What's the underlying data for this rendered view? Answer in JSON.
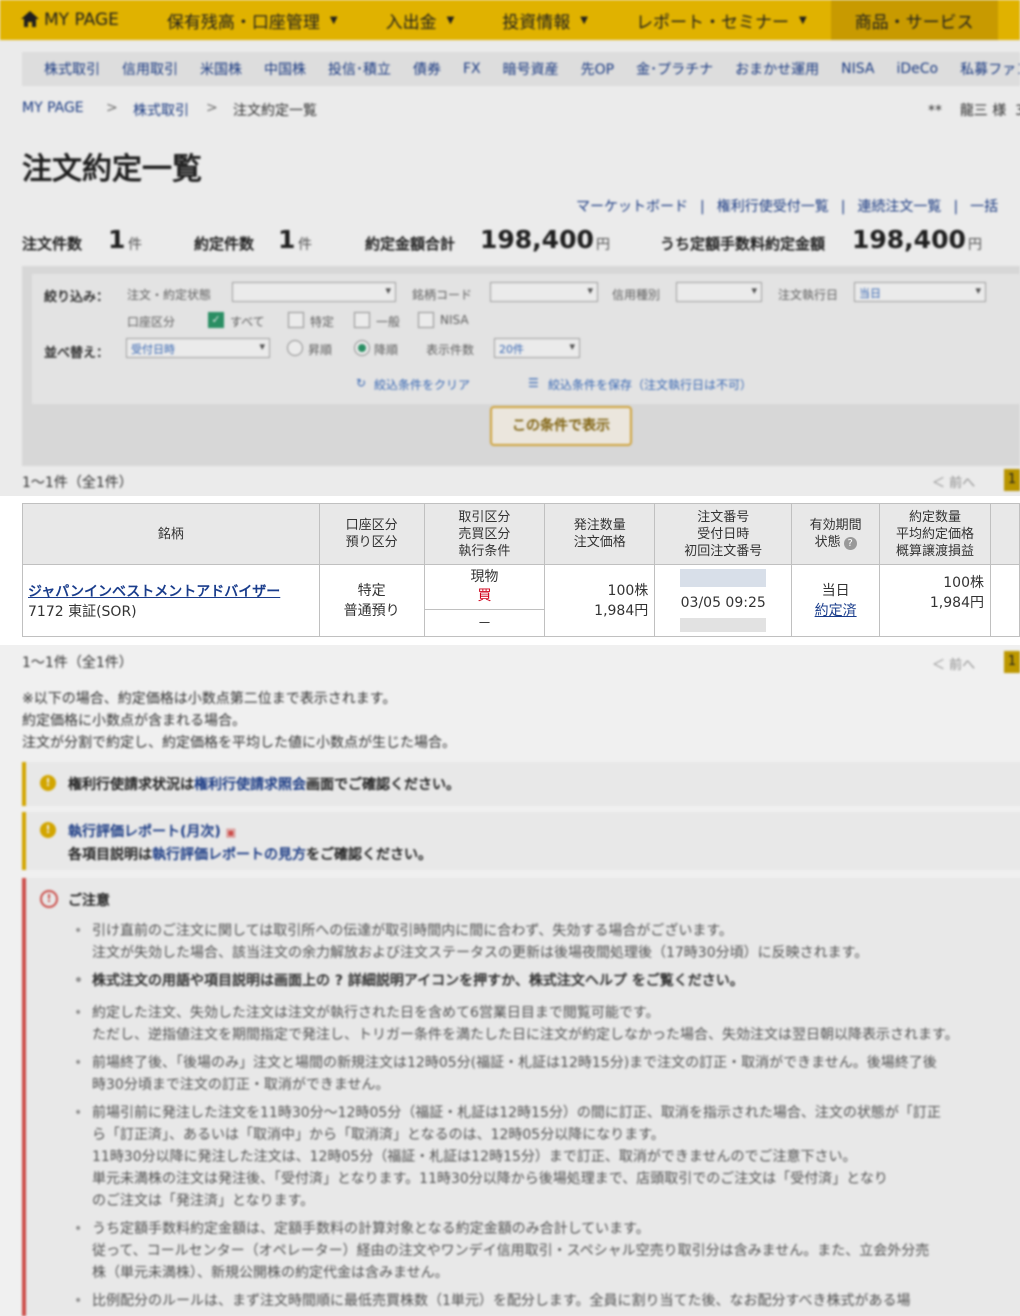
{
  "topnav": {
    "home": "MY PAGE",
    "items": [
      "保有残高・口座管理",
      "入出金",
      "投資情報",
      "レポート・セミナー",
      "商品・サービス"
    ]
  },
  "subnav": [
    "株式取引",
    "信用取引",
    "米国株",
    "中国株",
    "投信･積立",
    "債券",
    "FX",
    "暗号資産",
    "先OP",
    "金･プラチナ",
    "おまかせ運用",
    "NISA",
    "iDeCo",
    "私募ファンド"
  ],
  "breadcrumb": {
    "home": "MY PAGE",
    "sep": ">",
    "section": "株式取引",
    "current": "注文約定一覧"
  },
  "user": {
    "stars": "**",
    "name": "龍三 様",
    "trail": "3"
  },
  "page_title": "注文約定一覧",
  "links": {
    "market_board": "マーケットボード",
    "rights": "権利行使受付一覧",
    "chain": "連続注文一覧",
    "bulk": "一括",
    "sep": "|"
  },
  "summary": {
    "orders_label": "注文件数",
    "orders_value": "1",
    "orders_unit": "件",
    "exec_label": "約定件数",
    "exec_value": "1",
    "exec_unit": "件",
    "total_label": "約定金額合計",
    "total_value": "198,400",
    "total_unit": "円",
    "fixed_label": "うち定額手数料約定金額",
    "fixed_value": "198,400",
    "fixed_unit": "円"
  },
  "filter": {
    "narrow_label": "絞り込み：",
    "status_label": "注文・約定状態",
    "code_label": "銘柄コード",
    "margin_label": "信用種別",
    "exec_date_label": "注文執行日",
    "exec_date_value": "当日",
    "account_label": "口座区分",
    "acc_all": "すべて",
    "acc_specific": "特定",
    "acc_general": "一般",
    "acc_nisa": "NISA",
    "sort_label": "並べ替え：",
    "sort_value": "受付日時",
    "asc": "昇順",
    "desc": "降順",
    "count_label": "表示件数",
    "count_value": "20件",
    "clear": "絞込条件をクリア",
    "save": "絞込条件を保存（注文執行日は不可）",
    "show_button": "この条件で表示"
  },
  "count_text": "1〜1件（全1件）",
  "pager": {
    "prev": "＜ 前へ",
    "page": "1"
  },
  "table": {
    "headers": {
      "stock": "銘柄",
      "account": [
        "口座区分",
        "預り区分"
      ],
      "trade": [
        "取引区分",
        "売買区分",
        "執行条件"
      ],
      "qty": [
        "発注数量",
        "注文価格"
      ],
      "order": [
        "注文番号",
        "受付日時",
        "初回注文番号"
      ],
      "validity": [
        "有効期間",
        "状態"
      ],
      "exec": [
        "約定数量",
        "平均約定価格",
        "概算譲渡損益"
      ]
    },
    "row": {
      "stock_name": "ジャパンインベストメントアドバイザー",
      "stock_code": "7172 東証(SOR)",
      "account": "特定",
      "custody": "普通預り",
      "trade_type": "現物",
      "side": "買",
      "exec_cond": "－",
      "qty": "100株",
      "price": "1,984円",
      "received": "03/05 09:25",
      "validity": "当日",
      "status": "約定済",
      "exec_qty": "100株",
      "avg_price": "1,984円"
    }
  },
  "notes": [
    "※以下の場合、約定価格は小数点第二位まで表示されます。",
    "約定価格に小数点が含まれる場合。",
    "注文が分割で約定し、約定価格を平均した値に小数点が生じた場合。"
  ],
  "info1": {
    "pre": "権利行使請求状況は",
    "link": "権利行使請求照会",
    "post": "画面でご確認ください。"
  },
  "info2": {
    "link": "執行評価レポート(月次)",
    "pre": "各項目説明は",
    "link2": "執行評価レポートの見方",
    "post": "をご確認ください。"
  },
  "caution": {
    "title": "ご注意",
    "lines": [
      "引け直前のご注文に関しては取引所への伝達が取引時間内に間に合わず、失効する場合がございます。",
      "注文が失効した場合、該当注文の余力解放および注文ステータスの更新は後場夜間処理後（17時30分頃）に反映されます。",
      "株式注文の用語や項目説明は画面上の ? 詳細説明アイコンを押すか、株式注文ヘルプ をご覧ください。",
      "約定した注文、失効した注文は注文が執行された日を含めて6営業日目まで閲覧可能です。",
      "ただし、逆指値注文を期間指定で発注し、トリガー条件を満たした日に注文が約定しなかった場合、失効注文は翌日朝以降表示されます。",
      "前場終了後、「後場のみ」注文と場間の新規注文は12時05分(福証・札証は12時15分)まで注文の訂正・取消ができません。後場終了後",
      "時30分頃まで注文の訂正・取消ができません。",
      "前場引前に発注した注文を11時30分〜12時05分（福証・札証は12時15分）の間に訂正、取消を指示された場合、注文の状態が「訂正",
      "ら「訂正済」、あるいは「取消中」から「取消済」となるのは、12時05分以降になります。",
      "11時30分以降に発注した注文は、12時05分（福証・札証は12時15分）まで訂正、取消ができませんのでご注意下さい。",
      "単元未満株の注文は発注後、「受付済」となります。11時30分以降から後場処理まで、店頭取引でのご注文は「受付済」となり",
      "のご注文は「発注済」となります。",
      "うち定額手数料約定金額は、定額手数料の計算対象となる約定金額のみ合計しています。",
      "従って、コールセンター（オペレーター）経由の注文やワンデイ信用取引・スペシャル空売り取引分は含みません。また、立会外分売",
      "株（単元未満株）、新規公開株の約定代金は含みません。",
      "比例配分のルールは、まず注文時間順に最低売買株数（1単元）を配分します。全員に割り当てた後、なお配分すべき株式がある場"
    ]
  }
}
